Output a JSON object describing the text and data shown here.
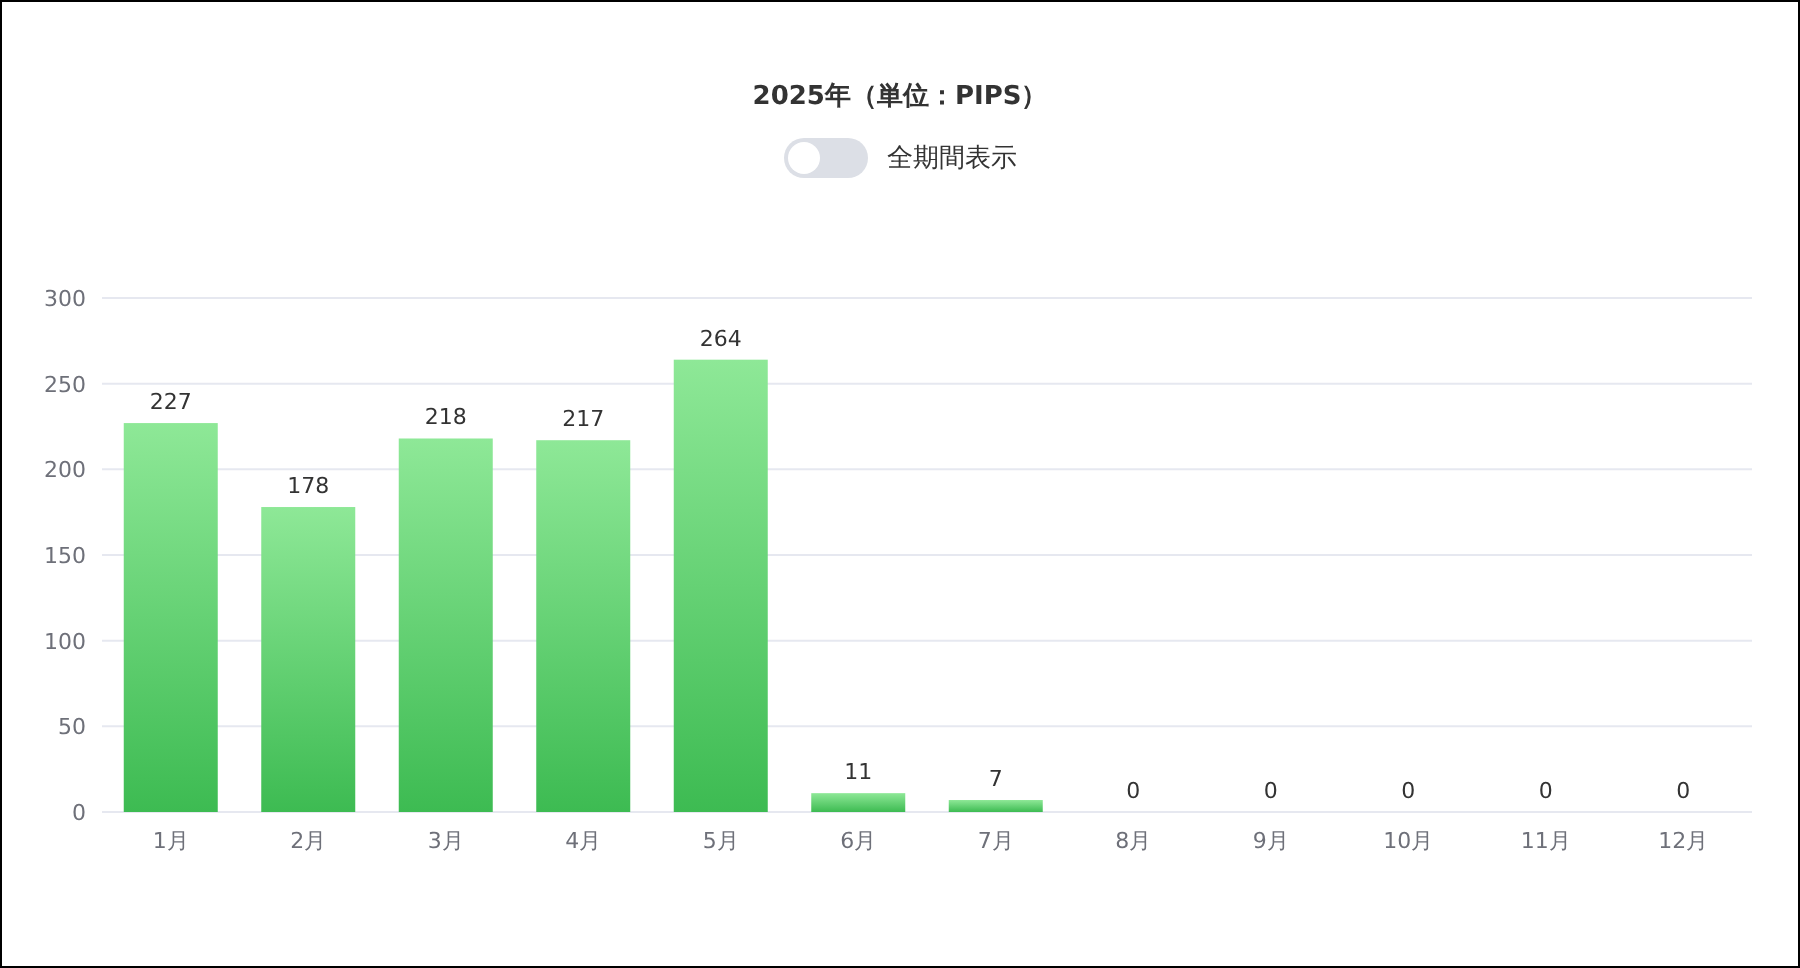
{
  "chart": {
    "toggle": {
      "label": "全期間表示",
      "on": false
    },
    "chart_data": {
      "type": "bar",
      "title": "2025年（単位：PIPS）",
      "categories": [
        "1月",
        "2月",
        "3月",
        "4月",
        "5月",
        "6月",
        "7月",
        "8月",
        "9月",
        "10月",
        "11月",
        "12月"
      ],
      "series": [
        {
          "color": "#3dbb52",
          "values": [
            227,
            178,
            218,
            217,
            264,
            11,
            7,
            0,
            0,
            0,
            0,
            0
          ]
        }
      ],
      "ylim": [
        0,
        300
      ],
      "yticks": [
        0,
        50,
        100,
        150,
        200,
        250,
        300
      ],
      "grid": true,
      "data_labels": true
    }
  }
}
